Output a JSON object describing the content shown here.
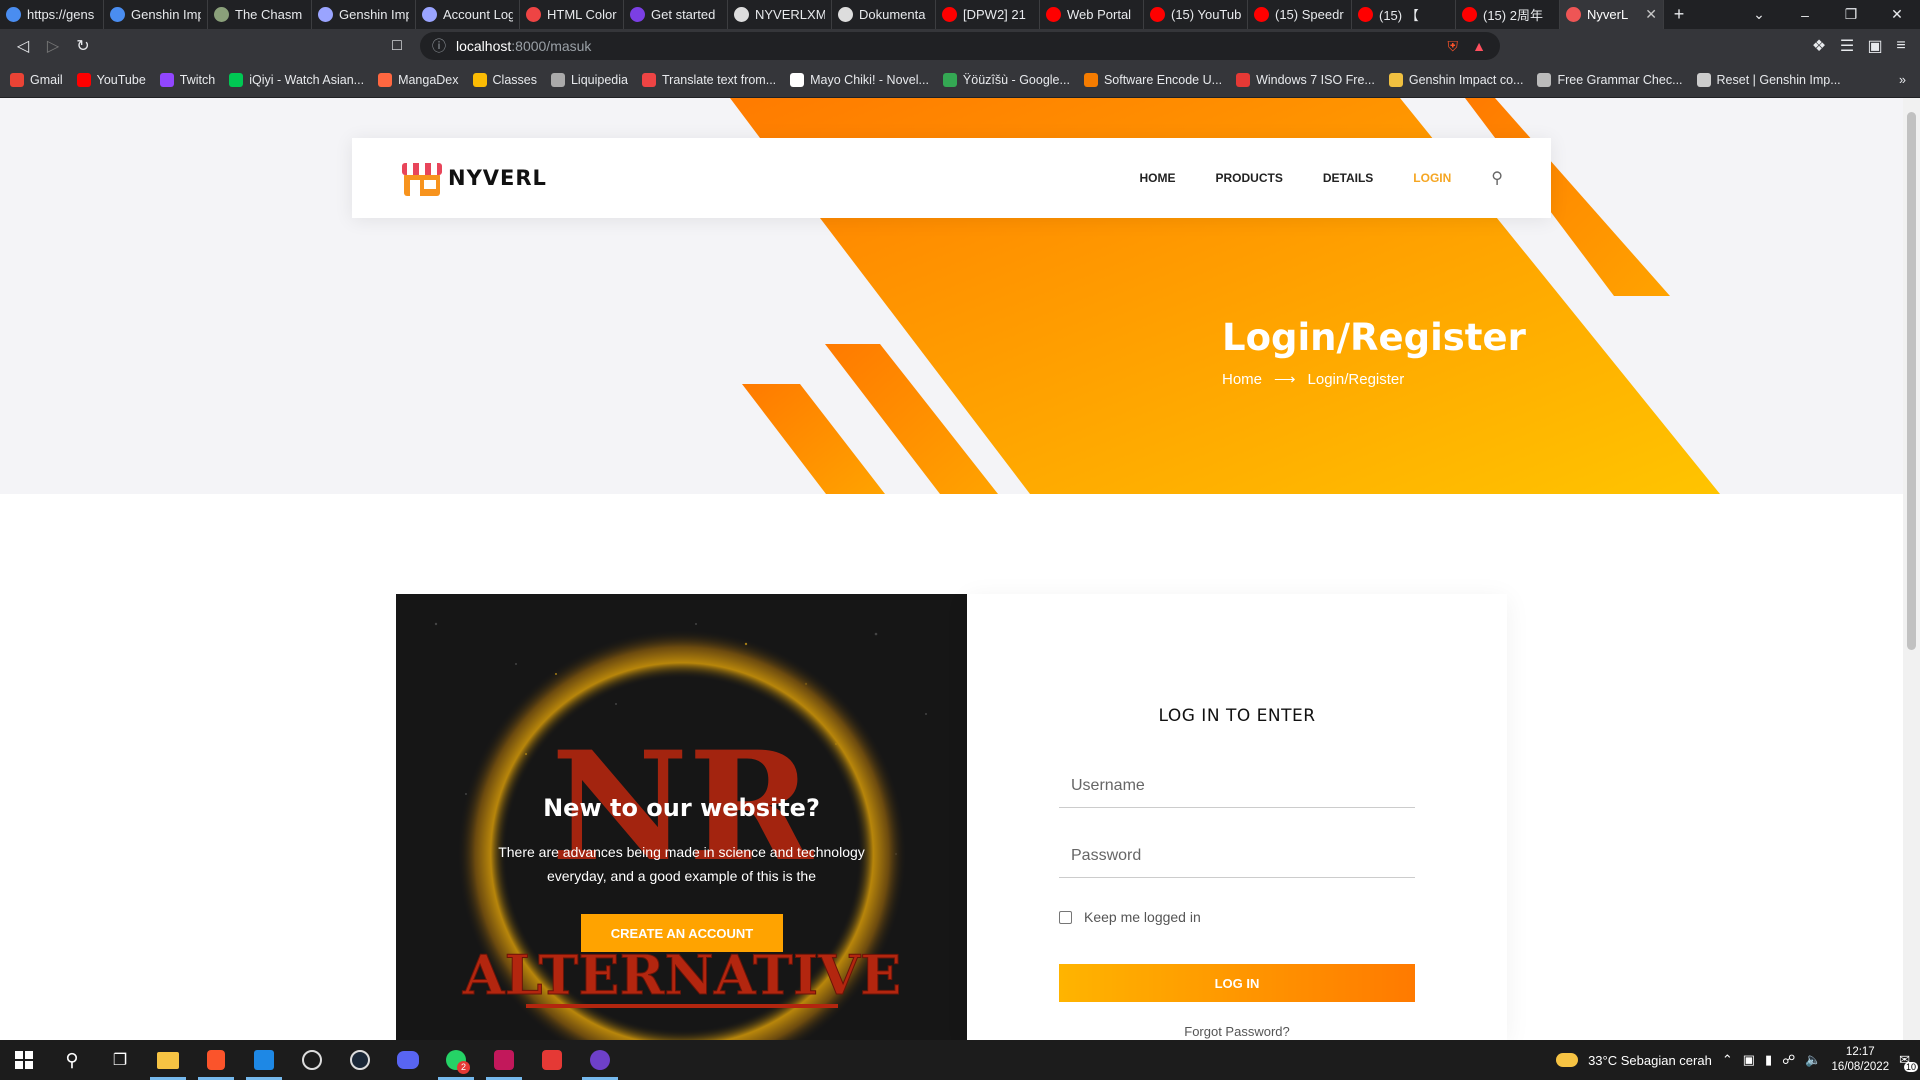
{
  "browser": {
    "tabs": [
      {
        "title": "https://gens",
        "color": "#4a8df0"
      },
      {
        "title": "Genshin Imp",
        "color": "#4a8df0"
      },
      {
        "title": "The Chasm",
        "color": "#8aa07a"
      },
      {
        "title": "Genshin Imp",
        "color": "#9aa4ff"
      },
      {
        "title": "Account Log",
        "color": "#9aa4ff"
      },
      {
        "title": "HTML Color",
        "color": "#e44"
      },
      {
        "title": "Get started",
        "color": "#7b3fe4"
      },
      {
        "title": "NYVERLXMA",
        "color": "#ddd"
      },
      {
        "title": "Dokumenta",
        "color": "#ddd"
      },
      {
        "title": "[DPW2] 21",
        "color": "#f00"
      },
      {
        "title": "Web Portal",
        "color": "#f00"
      },
      {
        "title": "(15) YouTub",
        "color": "#f00"
      },
      {
        "title": "(15) Speedr",
        "color": "#f00"
      },
      {
        "title": "(15) 【",
        "color": "#f00"
      },
      {
        "title": "(15) 2周年",
        "color": "#f00"
      },
      {
        "title": "NyverL",
        "color": "#e55"
      }
    ],
    "url_host": "localhost",
    "url_path": ":8000/masuk",
    "bookmarks": [
      {
        "label": "Gmail",
        "color": "#ea4335"
      },
      {
        "label": "YouTube",
        "color": "#f00"
      },
      {
        "label": "Twitch",
        "color": "#9146ff"
      },
      {
        "label": "iQiyi - Watch Asian...",
        "color": "#00c853"
      },
      {
        "label": "MangaDex",
        "color": "#ff6740"
      },
      {
        "label": "Classes",
        "color": "#fbbc04"
      },
      {
        "label": "Liquipedia",
        "color": "#aaa"
      },
      {
        "label": "Translate text from...",
        "color": "#e44"
      },
      {
        "label": "Mayo Chiki! - Novel...",
        "color": "#fff"
      },
      {
        "label": "Ÿöüzîšù - Google...",
        "color": "#34a853"
      },
      {
        "label": "Software Encode U...",
        "color": "#f57c00"
      },
      {
        "label": "Windows 7 ISO Fre...",
        "color": "#e53935"
      },
      {
        "label": "Genshin Impact co...",
        "color": "#f0c040"
      },
      {
        "label": "Free Grammar Chec...",
        "color": "#bbb"
      },
      {
        "label": "Reset | Genshin Imp...",
        "color": "#ccc"
      }
    ]
  },
  "nav": {
    "brand": "NYVERL",
    "links": [
      "HOME",
      "PRODUCTS",
      "DETAILS",
      "LOGIN"
    ]
  },
  "hero": {
    "title": "Login/Register",
    "crumb_home": "Home",
    "crumb_current": "Login/Register"
  },
  "promo": {
    "logo_letters": "NR",
    "logo_word": "ALTERNATIVE",
    "heading": "New to our website?",
    "text": "There are advances being made in science and technology everyday, and a good example of this is the",
    "button": "CREATE AN ACCOUNT"
  },
  "form": {
    "heading": "LOG IN TO ENTER",
    "username_placeholder": "Username",
    "password_placeholder": "Password",
    "remember": "Keep me logged in",
    "submit": "LOG IN",
    "forgot": "Forgot Password?"
  },
  "taskbar": {
    "weather": "33°C  Sebagian cerah",
    "time": "12:17",
    "date": "16/08/2022",
    "whatsapp_badge": "2",
    "notifications": "10"
  },
  "colors": {
    "accent": "#ffa300",
    "accent2": "#ff7a00",
    "login_active": "#f5a623"
  }
}
